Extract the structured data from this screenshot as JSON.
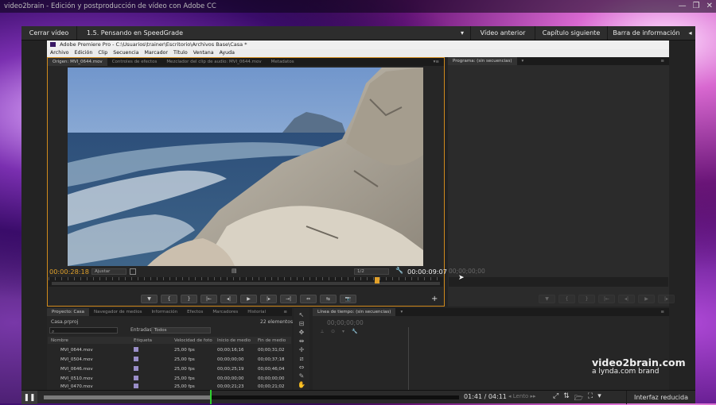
{
  "window": {
    "title": "video2brain - Edición y postproducción de vídeo con Adobe CC",
    "controls": [
      "—",
      "❐",
      "✕"
    ]
  },
  "nav": {
    "close_video": "Cerrar vídeo",
    "lesson": "1.5. Pensando en SpeedGrade",
    "lesson_arrow": "▾",
    "prev": "Vídeo anterior",
    "next": "Capítulo siguiente",
    "info": "Barra de información",
    "info_arrow": "◂"
  },
  "app": {
    "title": "Adobe Premiere Pro - C:\\Usuarios\\trainer\\Escritorio\\Archivos Base\\Casa *",
    "menu": [
      "Archivo",
      "Edición",
      "Clip",
      "Secuencia",
      "Marcador",
      "Título",
      "Ventana",
      "Ayuda"
    ]
  },
  "source": {
    "tabs": [
      "Origen: MVI_0644.mov",
      "Controles de efectos",
      "Mezclador del clip de audio: MVI_0644.mov",
      "Metadatos"
    ],
    "tab_menu": "▾≡",
    "timecode_in": "00:00:28:18",
    "fit": "Ajustar",
    "zoom": "1/2",
    "timecode_out": "00:00:09:07",
    "controls": [
      "▼",
      "{",
      "}",
      "|←",
      "◂|",
      "▶",
      "|▸",
      "→|",
      "⇔",
      "⇆",
      "📷"
    ],
    "add": "+"
  },
  "program": {
    "tab": "Programa: (sin secuencias)",
    "tab_arrow": "▾",
    "tab_menu": "≡",
    "timecode": "00;00;00;00",
    "controls": [
      "▼",
      "{",
      "}",
      "|←",
      "◂|",
      "▶",
      "|▸"
    ]
  },
  "project": {
    "tabs": [
      "Proyecto: Casa",
      "Navegador de medios",
      "Información",
      "Efectos",
      "Marcadores",
      "Historial"
    ],
    "tab_menu": "≡",
    "file": "Casa.prproj",
    "count": "22 elementos",
    "search_icon": "⌕",
    "entries_label": "Entradas:",
    "entries_value": "Todos",
    "columns": [
      "Nombre",
      "Etiqueta",
      "Velocidad de foto",
      "Inicio de medio",
      "Fin de medio"
    ],
    "rows": [
      {
        "name": "MVI_0644.mov",
        "fps": "25,00 fps",
        "start": "00;00;16;16",
        "end": "00;00;31;02"
      },
      {
        "name": "MVI_0504.mov",
        "fps": "25,00 fps",
        "start": "00;00;00;00",
        "end": "00;00;37;18"
      },
      {
        "name": "MVI_0646.mov",
        "fps": "25,00 fps",
        "start": "00;00;25;19",
        "end": "00;00;46;04"
      },
      {
        "name": "MVI_0510.mov",
        "fps": "25,00 fps",
        "start": "00;00;00;00",
        "end": "00;00;00;00"
      },
      {
        "name": "MVI_0470.mov",
        "fps": "25,00 fps",
        "start": "00;00;21;23",
        "end": "00;00;21;02"
      }
    ]
  },
  "tools": [
    "↖",
    "⊟",
    "✥",
    "⇹",
    "✛",
    "⧄",
    "⇔",
    "✎",
    "✋",
    "🔍"
  ],
  "timeline": {
    "tab": "Línea de tiempo: (sin secuencias)",
    "tab_arrow": "▾",
    "tab_menu": "≡",
    "timecode": "00;00;00;00"
  },
  "brand": {
    "line1": "video2brain.com",
    "line2": "a lynda.com brand"
  },
  "player": {
    "play_icon": "❚❚",
    "time": "01:41 / 04:11",
    "progress": 0.405,
    "speed": "◂ Lento ▸▸",
    "icons": [
      "⤢",
      "⇅",
      "🗁",
      "⛶",
      "▾"
    ],
    "reduced": "Interfaz reducida"
  }
}
